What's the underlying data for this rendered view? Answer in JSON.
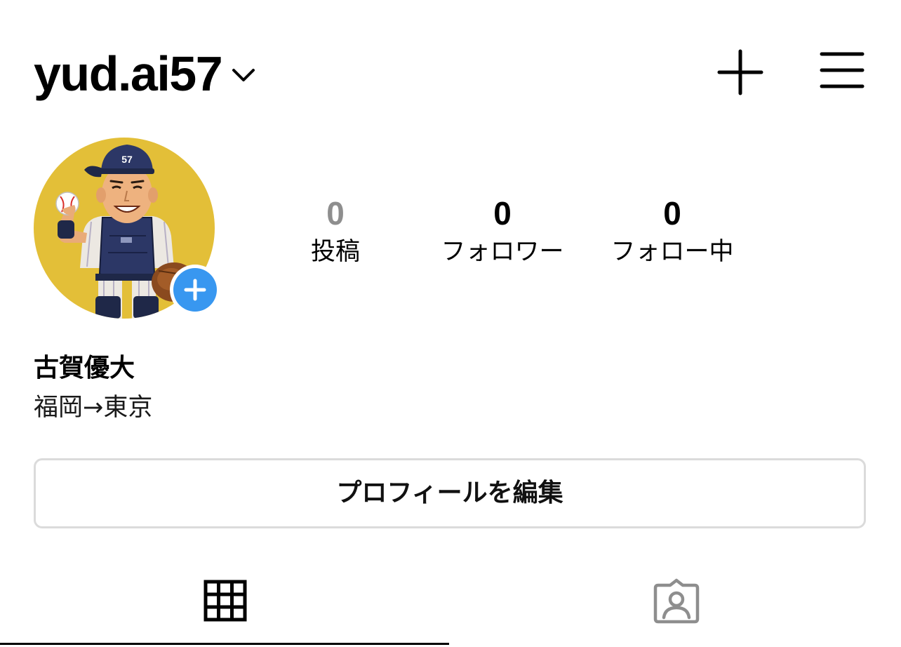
{
  "header": {
    "username": "yud.ai57",
    "icons": {
      "dropdown": "chevron-down-icon",
      "create": "plus-icon",
      "menu": "hamburger-menu-icon"
    }
  },
  "profile": {
    "avatar": {
      "icon": "avatar-baseball-catcher-illustration",
      "cap_number": "57",
      "background_color": "#e3bf38"
    },
    "add_story_icon": "add-story-plus-icon",
    "accent_color": "#3897f0",
    "stats": {
      "posts": {
        "value": "0",
        "label": "投稿"
      },
      "followers": {
        "value": "0",
        "label": "フォロワー"
      },
      "following": {
        "value": "0",
        "label": "フォロー中"
      }
    },
    "full_name": "古賀優大",
    "bio": "福岡→東京",
    "edit_button_label": "プロフィールを編集"
  },
  "tabs": [
    {
      "name": "posts-grid",
      "icon": "grid-icon",
      "active": true
    },
    {
      "name": "tagged",
      "icon": "tagged-person-icon",
      "active": false
    }
  ]
}
